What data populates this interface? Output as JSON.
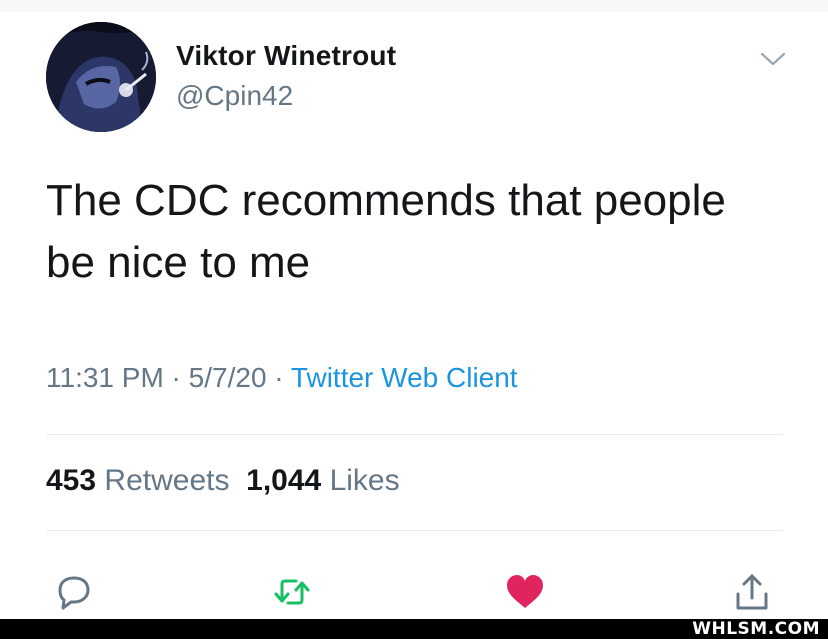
{
  "tweet": {
    "author": {
      "display_name": "Viktor Winetrout",
      "handle": "@Cpin42",
      "avatar_icon": "avatar-image"
    },
    "menu_icon": "chevron-down-icon",
    "text_lines": [
      "The CDC recommends that people",
      "be nice to me"
    ],
    "meta": {
      "time": "11:31 PM",
      "separator": " · ",
      "date": "5/7/20",
      "client": "Twitter Web Client"
    },
    "stats": {
      "retweets_count": "453",
      "retweets_label": "Retweets",
      "likes_count": "1,044",
      "likes_label": "Likes"
    },
    "actions": {
      "reply_icon": "reply-icon",
      "retweet_icon": "retweet-icon",
      "like_icon": "heart-icon",
      "share_icon": "share-icon"
    },
    "colors": {
      "link": "#1b95e0",
      "secondary_text": "#657786",
      "retweet": "#17bf63",
      "like": "#e0245e"
    }
  },
  "watermark": "WHLSM.COM"
}
